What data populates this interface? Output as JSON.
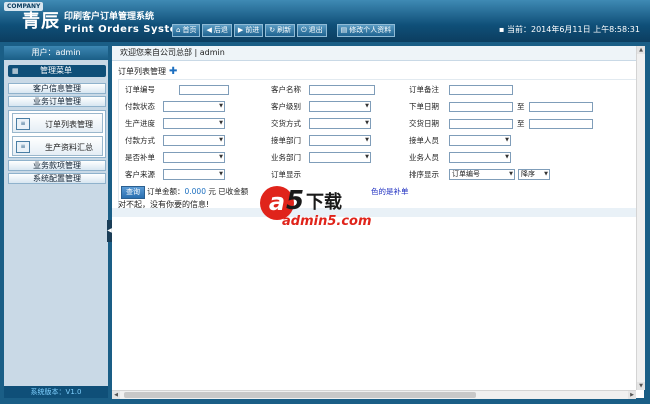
{
  "header": {
    "company_badge": "COMPANY",
    "logo_cn": "青辰",
    "title_cn": "印刷客户订单管理系统",
    "title_en": "Print Orders System",
    "toolbar": [
      {
        "name": "home",
        "icon": "home-icon",
        "glyph": "⌂",
        "label": "首页"
      },
      {
        "name": "back",
        "icon": "back-arrow-icon",
        "glyph": "◀",
        "label": "后退"
      },
      {
        "name": "forward",
        "icon": "forward-arrow-icon",
        "glyph": "▶",
        "label": "前进"
      },
      {
        "name": "refresh",
        "icon": "refresh-icon",
        "glyph": "↻",
        "label": "刷新"
      },
      {
        "name": "logout",
        "icon": "power-icon",
        "glyph": "⏻",
        "label": "退出"
      }
    ],
    "profile_button": {
      "glyph": "▤",
      "label": "修改个人资料"
    },
    "datetime": "▪ 当前：2014年6月11日 上午8:58:31"
  },
  "sidebar": {
    "user": "用户：admin",
    "menu_header": "管理菜单",
    "items": [
      {
        "label": "客户信息管理"
      },
      {
        "label": "业务订单管理"
      }
    ],
    "sub_items": [
      {
        "label": "订单列表管理"
      },
      {
        "label": "生产资料汇总"
      }
    ],
    "items_after": [
      {
        "label": "业务款项管理"
      },
      {
        "label": "系统配置管理"
      }
    ],
    "version": "系统版本：V1.0"
  },
  "main": {
    "welcome": "欢迎您来自公司总部 | admin",
    "panel_title": "订单列表管理",
    "form": {
      "order_no": "订单编号",
      "customer_name": "客户名称",
      "order_remark": "订单备注",
      "pay_status": "付款状态",
      "customer_level": "客户级别",
      "order_date": "下单日期",
      "progress": "生产进度",
      "delivery_method": "交货方式",
      "delivery_date": "交货日期",
      "pay_method": "付款方式",
      "receiving_dept": "接单部门",
      "receiver": "接单人员",
      "is_supplement": "是否补单",
      "business_dept": "业务部门",
      "salesperson": "业务人员",
      "customer_source": "客户来源",
      "hidden_label": "订单显示",
      "sort_display": "排序显示",
      "to": "至",
      "sort_field": "订单编号",
      "sort_order": "降序",
      "query_button": "查询",
      "amount_label": "订单金额：",
      "amount_value": "0.000",
      "amount_suffix": "元 已收金额",
      "note": "色的是补单"
    },
    "no_result": "对不起，没有你要的信息!"
  },
  "watermark": {
    "letter": "a",
    "digit": "5",
    "cn": "下载",
    "url": "admin5.com"
  }
}
